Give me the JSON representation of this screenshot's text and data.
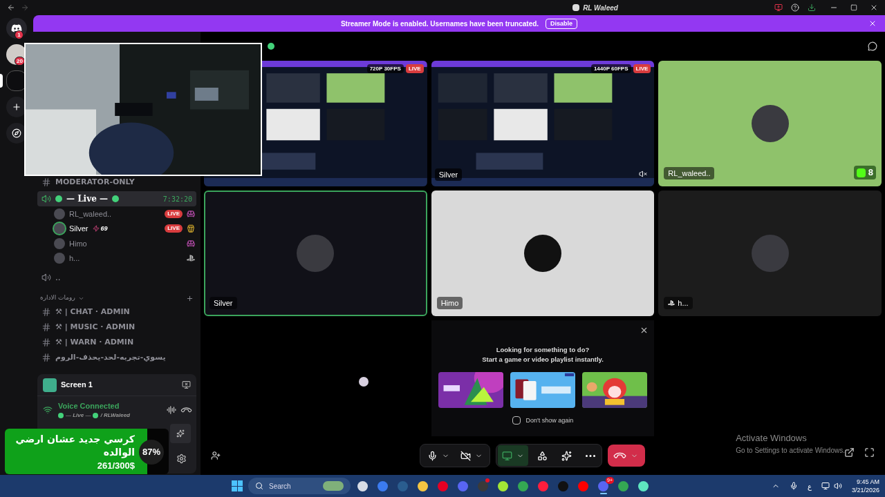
{
  "titlebar": {
    "title": "RL Waleed"
  },
  "servers": [
    {
      "kind": "home",
      "badge": "1",
      "selected": false
    },
    {
      "kind": "avatar",
      "badge": "20",
      "selected": false
    },
    {
      "kind": "server",
      "selected": true
    },
    {
      "kind": "add",
      "selected": false
    },
    {
      "kind": "discover",
      "selected": false
    }
  ],
  "banner": {
    "text": "Streamer Mode is enabled. Usernames have been truncated.",
    "button": "Disable"
  },
  "channels": [
    {
      "kind": "text",
      "name": "MODERATOR-ONLY"
    },
    {
      "kind": "voice",
      "name": "— Live —",
      "decorated": true,
      "timer": "7:32:20",
      "selected": true,
      "members": [
        {
          "kind": "sofa",
          "name": "RL_waleed..",
          "speaking": false,
          "live": "LIVE"
        },
        {
          "kind": "popcorn",
          "name": "Silver",
          "speaking": true,
          "boost": "69",
          "live": "LIVE"
        },
        {
          "kind": "sofa",
          "name": "Himo",
          "speaking": false
        },
        {
          "kind": "console",
          "name": "h...",
          "speaking": false
        }
      ]
    },
    {
      "kind": "voice",
      "name": "..",
      "decorated": false,
      "selected": false
    },
    {
      "kind": "category",
      "name": "رومات الاداره"
    },
    {
      "kind": "text",
      "name": "⚒ | CHAT · ADMIN"
    },
    {
      "kind": "text",
      "name": "⚒ | MUSIC · ADMIN"
    },
    {
      "kind": "text",
      "name": "⚒ | WARN · ADMIN"
    },
    {
      "kind": "text",
      "name": "يسوي-تجربه-لحد-يحذف-الروم"
    }
  ],
  "voice_panel": {
    "stream": "Screen 1",
    "status": "Voice Connected",
    "channel": "— Live —",
    "server": "/ RLWaleed"
  },
  "donation": {
    "title": "كرسي جديد عشان ارضي الوالده",
    "amount": "261/300$",
    "percent": "87%",
    "level": 0.87
  },
  "tiles": [
    {
      "kind": "stream",
      "quality": "720P 30FPS",
      "live": "LIVE"
    },
    {
      "kind": "stream",
      "quality": "1440P 60FPS",
      "live": "LIVE",
      "name": "Silver",
      "muted": true
    },
    {
      "kind": "user",
      "name": "RL_waleed..",
      "color": "#8fc26b",
      "speaking": false,
      "badge": "8"
    },
    {
      "kind": "user",
      "name": "Silver",
      "color": "#111118",
      "speaking": true
    },
    {
      "kind": "user",
      "name": "Himo",
      "color": "#d9d9d9",
      "speaking": false
    },
    {
      "kind": "console",
      "name": "h...",
      "color": "#1c1c1c",
      "speaking": false
    }
  ],
  "activity": {
    "heading": "Looking for something to do?",
    "subheading": "Start a game or video playlist instantly.",
    "checkbox": {
      "label": "Don't show again",
      "checked": false
    }
  },
  "controls": [
    {
      "kind": "mic",
      "menu": true
    },
    {
      "kind": "camera",
      "off": true,
      "menu": true
    },
    {
      "kind": "screen",
      "on": true,
      "menu": true
    },
    {
      "kind": "activities"
    },
    {
      "kind": "soundboard"
    },
    {
      "kind": "more"
    },
    {
      "kind": "hangup",
      "menu": true
    }
  ],
  "watermark": {
    "title": "Activate Windows",
    "text": "Go to Settings to activate Windows."
  },
  "taskbar": {
    "search": "Search",
    "apps": [
      {
        "color": "#d7dde6"
      },
      {
        "color": "#3b7bf0"
      },
      {
        "color": "#2a5d8f"
      },
      {
        "color": "#f4c542"
      },
      {
        "color": "#e60023"
      },
      {
        "color": "#5865f2"
      },
      {
        "color": "#3a3a3a",
        "dot": true
      },
      {
        "color": "#a3e635"
      },
      {
        "color": "#34a853"
      },
      {
        "color": "#ff1e3c"
      },
      {
        "color": "#111111"
      },
      {
        "color": "#ff0000"
      },
      {
        "color": "#5865f2",
        "badge": "9+",
        "active": true
      },
      {
        "color": "#34a853"
      },
      {
        "color": "#5ee6c0"
      }
    ],
    "lang": "ع",
    "time": "9:45 AM",
    "date": "3/21/2026"
  }
}
